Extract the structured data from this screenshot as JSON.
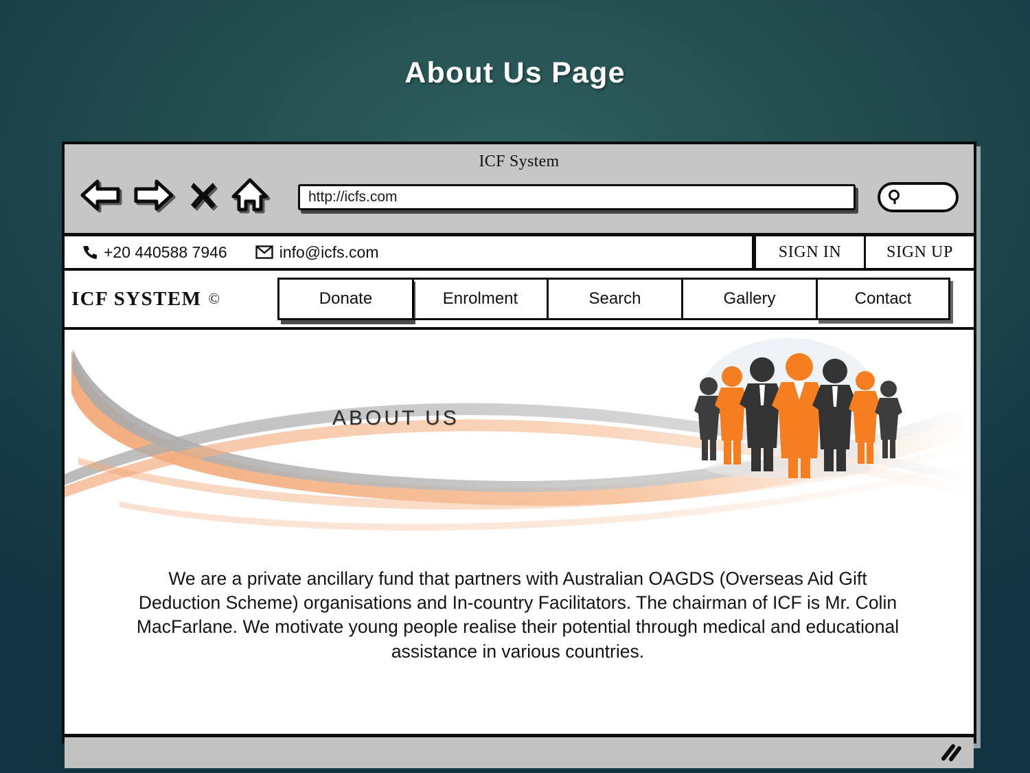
{
  "slide": {
    "title": "About Us Page",
    "background_color_center": "#2e6060",
    "background_color_edge": "#123440"
  },
  "browser": {
    "window_title": "ICF System",
    "toolbar": {
      "back_icon": "back-arrow-icon",
      "forward_icon": "forward-arrow-icon",
      "stop_icon": "close-x-icon",
      "home_icon": "home-icon",
      "url": "http://icfs.com",
      "url_placeholder": "http://icfs.com",
      "search_icon": "search-magnifier-icon",
      "search_value": ""
    },
    "status_bar": {
      "resize_grip_icon": "resize-grip-icon"
    }
  },
  "contact_strip": {
    "phone_icon": "phone-icon",
    "phone": "+20 440588 7946",
    "email_icon": "envelope-icon",
    "email": "info@icfs.com",
    "sign_in": "SIGN IN",
    "sign_up": "SIGN UP"
  },
  "site_nav": {
    "logo": "ICF SYSTEM",
    "logo_copyright": "©",
    "items": [
      {
        "label": "Donate",
        "active": true
      },
      {
        "label": "Enrolment",
        "active": false
      },
      {
        "label": "Search",
        "active": false
      },
      {
        "label": "Gallery",
        "active": false
      },
      {
        "label": "Contact",
        "active": false
      }
    ]
  },
  "page": {
    "hero_heading": "ABOUT US",
    "hero_accent_color": "#f0a070",
    "hero_gray_color": "#b3b3b3",
    "people_orange": "#f57e20",
    "people_dark": "#3a3a3a",
    "body_text": "We are a private ancillary fund that partners with Australian OAGDS (Overseas Aid Gift Deduction Scheme) organisations and In-country Facilitators. The chairman of ICF is Mr. Colin MacFarlane. We motivate young people realise their potential through medical and educational assistance in various countries."
  }
}
